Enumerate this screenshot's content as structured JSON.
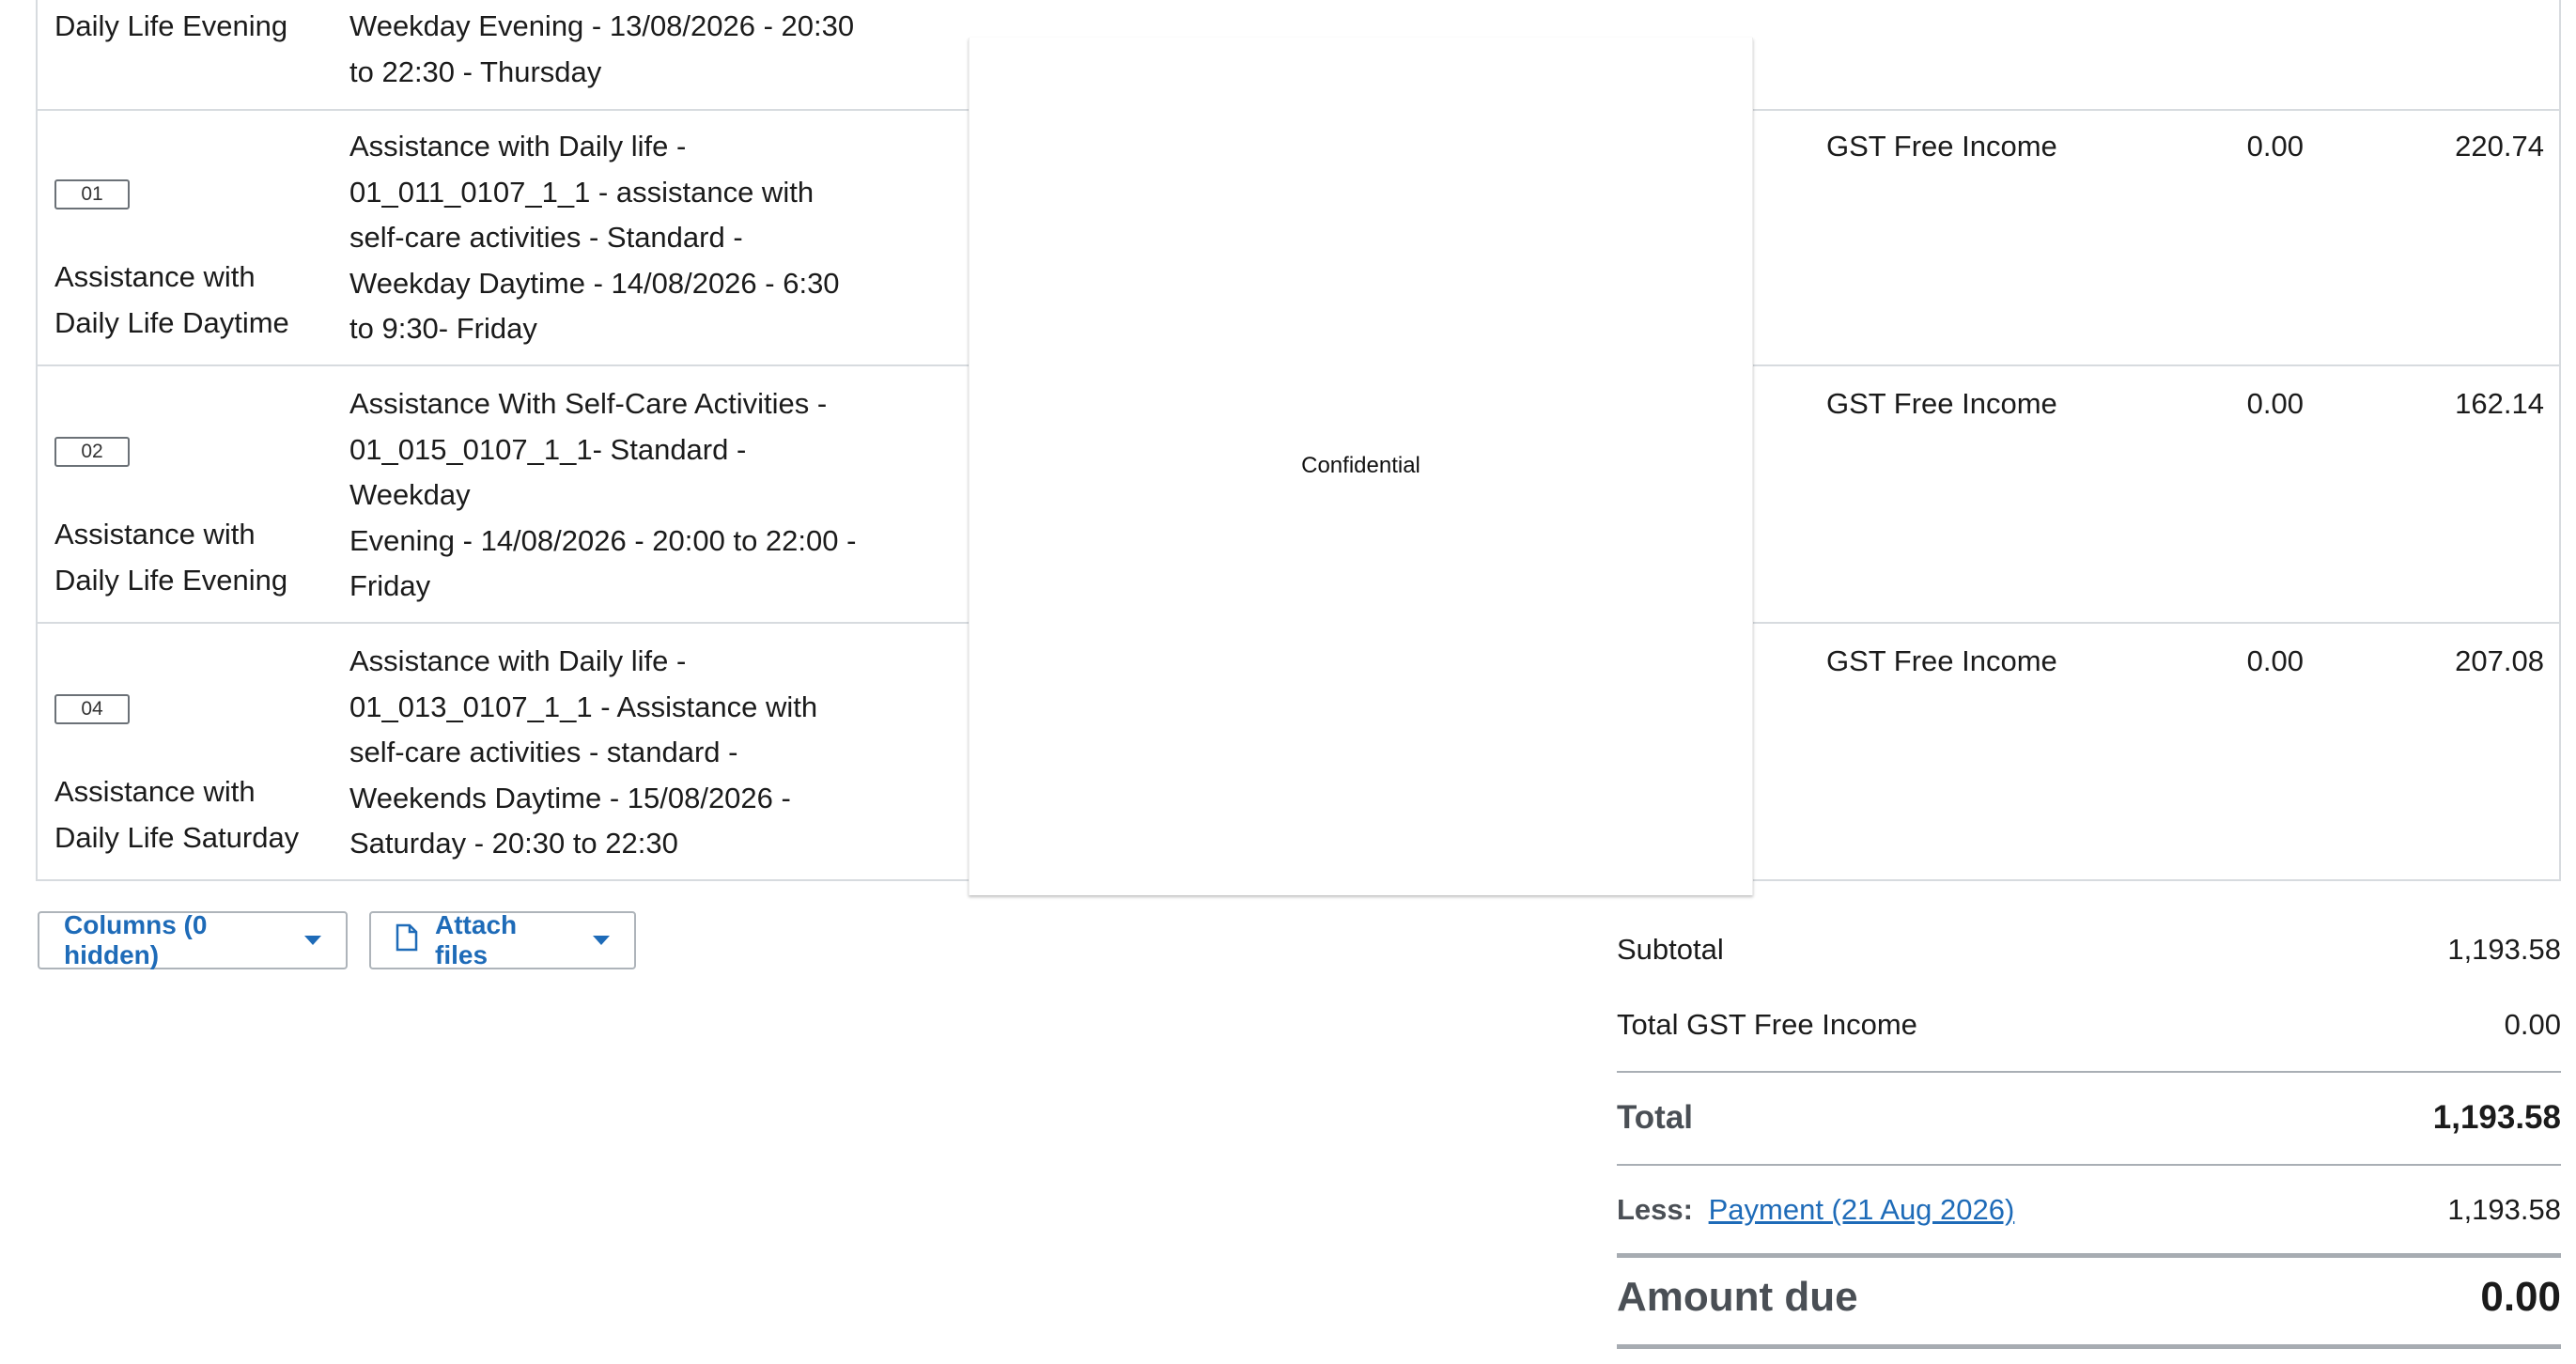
{
  "line_items": [
    {
      "code": "",
      "item": "Daily Life Evening",
      "description": "Weekday Evening - 13/08/2026 - 20:30\nto 22:30 - Thursday",
      "account": "",
      "tax": "",
      "amount": ""
    },
    {
      "code": "01",
      "item": "Assistance with\nDaily Life Daytime",
      "description": "Assistance with Daily life -\n01_011_0107_1_1 - assistance with\nself-care activities - Standard -\nWeekday Daytime - 14/08/2026 - 6:30\nto 9:30- Friday",
      "account": "GST Free Income",
      "tax": "0.00",
      "amount": "220.74"
    },
    {
      "code": "02",
      "item": "Assistance with\nDaily Life Evening",
      "description": "Assistance With Self-Care Activities -\n01_015_0107_1_1- Standard -\nWeekday\nEvening - 14/08/2026 - 20:00 to 22:00 -\nFriday",
      "account": "GST Free Income",
      "tax": "0.00",
      "amount": "162.14"
    },
    {
      "code": "04",
      "item": "Assistance with\nDaily Life Saturday",
      "description": "Assistance with Daily life -\n01_013_0107_1_1 - Assistance with\nself-care activities - standard -\nWeekends Daytime - 15/08/2026 -\nSaturday - 20:30 to 22:30",
      "account": "GST Free Income",
      "tax": "0.00",
      "amount": "207.08"
    }
  ],
  "overlay": {
    "text": "Confidential"
  },
  "buttons": {
    "columns_label": "Columns (0 hidden)",
    "attach_label": "Attach files"
  },
  "totals": {
    "subtotal_label": "Subtotal",
    "subtotal_value": "1,193.58",
    "tax_label": "Total GST Free Income",
    "tax_value": "0.00",
    "total_label": "Total",
    "total_value": "1,193.58",
    "less_label": "Less:",
    "payment_link": "Payment (21 Aug 2026)",
    "payment_value": "1,193.58",
    "amount_due_label": "Amount due",
    "amount_due_value": "0.00"
  },
  "colors": {
    "link": "#1e6bb8",
    "border": "#d7dbdf"
  },
  "icons": [
    "file-icon",
    "caret-down-icon"
  ]
}
